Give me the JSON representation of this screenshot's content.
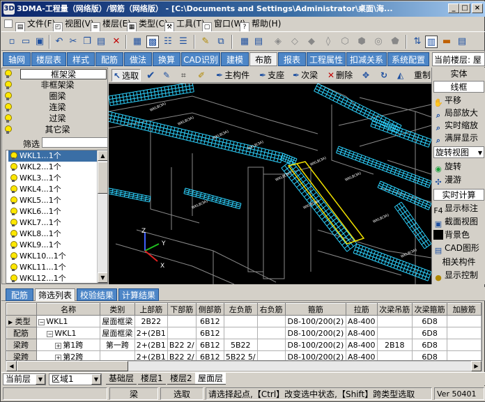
{
  "window": {
    "title": "3DMA-工程量（网络版）/钢筋（网络版） - [C:\\Documents and Settings\\Administrator\\桌面\\海...",
    "icon": "app-icon",
    "controls": [
      "_",
      "□",
      "×"
    ]
  },
  "menu": [
    {
      "label": "文件(F)",
      "icon": "file-menu-icon"
    },
    {
      "label": "视图(V)",
      "icon": "view-menu-icon"
    },
    {
      "label": "楼层(E)",
      "icon": "floor-menu-icon"
    },
    {
      "label": "类型(C)",
      "icon": "type-menu-icon"
    },
    {
      "label": "工具(T)",
      "icon": "tools-menu-icon"
    },
    {
      "label": "窗口(W)",
      "icon": "window-menu-icon"
    },
    {
      "label": "帮助(H)",
      "icon": "help-menu-icon"
    }
  ],
  "module_tabs": [
    "轴网",
    "楼层表",
    "样式",
    "配筋",
    "做法",
    "换算",
    "CAD识别",
    "建模",
    "布筋",
    "报表",
    "工程属性",
    "扣减关系",
    "系统配置"
  ],
  "active_module_tab": "布筋",
  "current_floor_label": "当前楼层: 屋",
  "categories": [
    "框架梁",
    "非框架梁",
    "圈梁",
    "连梁",
    "过梁",
    "其它梁"
  ],
  "filter": {
    "label": "筛选",
    "value": ""
  },
  "beam_list": [
    "WKL1...1个",
    "WKL2...1个",
    "WKL3...1个",
    "WKL4...1个",
    "WKL5...1个",
    "WKL6...1个",
    "WKL7...1个",
    "WKL8...1个",
    "WKL9...1个",
    "WKL10...1个",
    "WKL11...1个",
    "WKL12...1个"
  ],
  "selected_beam_index": 0,
  "draw_toolbar": [
    {
      "label": "选取",
      "icon": "select-arrow-icon"
    },
    {
      "label": "",
      "icon": "check-icon"
    },
    {
      "label": "",
      "icon": "edit-pencil-icon"
    },
    {
      "label": "",
      "icon": "box-select-icon"
    },
    {
      "label": "",
      "icon": "paint-brush-icon"
    },
    {
      "label": "主构件",
      "icon": "main-member-icon"
    },
    {
      "label": "支座",
      "icon": "support-icon"
    },
    {
      "label": "次梁",
      "icon": "secondary-beam-icon"
    },
    {
      "label": "删除",
      "icon": "delete-x-icon"
    },
    {
      "label": "",
      "icon": "move-icon"
    },
    {
      "label": "",
      "icon": "rotate-icon"
    },
    {
      "label": "",
      "icon": "mirror-icon"
    },
    {
      "label": "重制",
      "icon": ""
    }
  ],
  "canvas": {
    "axis_labels": {
      "z": "Z",
      "y": "Y",
      "x": "X"
    },
    "beam_tag": "WKL8(3A)"
  },
  "right_panel": {
    "header1": "实体",
    "header2": "线框",
    "items": [
      {
        "label": "平移",
        "icon": "pan-icon"
      },
      {
        "label": "局部放大",
        "icon": "zoom-window-icon"
      },
      {
        "label": "实时缩放",
        "icon": "zoom-realtime-icon"
      },
      {
        "label": "满屏显示",
        "icon": "zoom-extents-icon"
      }
    ],
    "rotate_view": "旋转视图",
    "items2": [
      {
        "label": "旋转",
        "icon": "orbit-icon"
      },
      {
        "label": "漫游",
        "icon": "walk-icon"
      }
    ],
    "calc_button": "实时计算",
    "items3": [
      {
        "label": "显示标注",
        "icon": "F4"
      },
      {
        "label": "截面视图",
        "icon": "section-view-icon"
      },
      {
        "label": "背景色",
        "icon": "background-color-icon"
      },
      {
        "label": "CAD图形",
        "icon": "cad-drawing-icon"
      }
    ],
    "related": "相关构件",
    "display_control": "显示控制"
  },
  "bottom_tabs": [
    "配筋",
    "筛选列表",
    "校验结果",
    "计算结果"
  ],
  "active_bottom_tab": "筛选列表",
  "table": {
    "columns": [
      "名称",
      "类别",
      "上部筋",
      "下部筋",
      "侧部筋",
      "左负筋",
      "右负筋",
      "箍筋",
      "拉筋",
      "次梁吊筋",
      "次梁箍筋",
      "加腋筋"
    ],
    "rows": [
      {
        "header": "类型",
        "tree": "⊟",
        "cells": [
          "WKL1",
          "屋面框梁",
          "2B22",
          "",
          "6B12",
          "",
          "",
          "D8-100/200(2)",
          "A8-400",
          "",
          "6D8",
          ""
        ]
      },
      {
        "header": "配筋",
        "tree": "⊟",
        "cells": [
          "WKL1",
          "屋面框梁",
          "2+(2B1",
          "",
          "6B12",
          "",
          "",
          "D8-100/200(2)",
          "A8-400",
          "",
          "6D8",
          ""
        ]
      },
      {
        "header": "梁跨",
        "tree": "⊞",
        "cells": [
          "第1跨",
          "第一跨",
          "2+(2B1",
          "B22 2/",
          "6B12",
          "5B22",
          "",
          "D8-100/200(2)",
          "A8-400",
          "2B18",
          "6D8",
          ""
        ]
      },
      {
        "header": "梁跨",
        "tree": "⊞",
        "cells": [
          "第2跨",
          "",
          "2+(2B1",
          "B22 2/",
          "6B12",
          "5B22 5/",
          "",
          "D8-100/200(2)",
          "A8-400",
          "",
          "6D8",
          ""
        ]
      }
    ]
  },
  "floor_bar": {
    "floor_combo": "当前层",
    "region_combo": "区域1",
    "floor_tabs": [
      "基础层",
      "楼层1",
      "楼层2",
      "屋面层"
    ],
    "active_floor_tab": "屋面层"
  },
  "status": {
    "component": "梁",
    "mode": "选取",
    "hint": "请选择起点,【Ctrl】改变选中状态,【Shift】跨类型选取",
    "version": "Ver 50401"
  },
  "colors": {
    "tab_blue": "#4d86c7",
    "rebar_cyan": "#2ed3ff",
    "selected_yellow": "#f0e000",
    "background": "#000000"
  }
}
